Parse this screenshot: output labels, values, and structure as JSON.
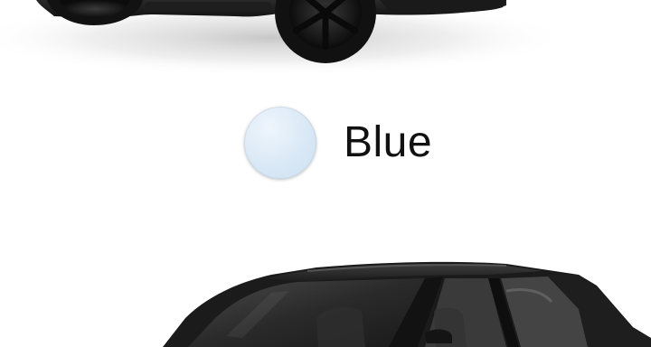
{
  "car_top": {
    "image_name": "car-side-view-image",
    "body_color": "#1c1c1c"
  },
  "color_option": {
    "label": "Blue",
    "swatch_color": "#d4e5f4",
    "swatch_highlight": "#eef5fc"
  },
  "car_bottom": {
    "image_name": "car-front-three-quarter-image",
    "body_color": "#262626"
  }
}
